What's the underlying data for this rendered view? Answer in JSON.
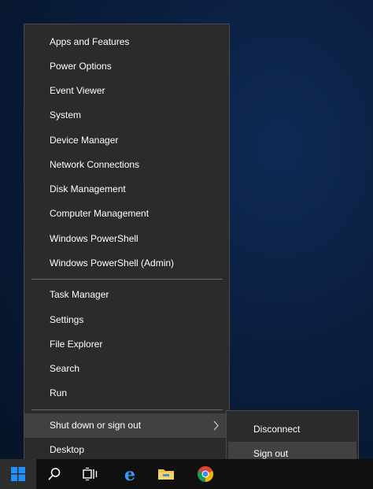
{
  "menu": {
    "items": [
      {
        "label": "Apps and Features"
      },
      {
        "label": "Power Options"
      },
      {
        "label": "Event Viewer"
      },
      {
        "label": "System"
      },
      {
        "label": "Device Manager"
      },
      {
        "label": "Network Connections"
      },
      {
        "label": "Disk Management"
      },
      {
        "label": "Computer Management"
      },
      {
        "label": "Windows PowerShell"
      },
      {
        "label": "Windows PowerShell (Admin)"
      },
      {
        "label": "Task Manager"
      },
      {
        "label": "Settings"
      },
      {
        "label": "File Explorer"
      },
      {
        "label": "Search"
      },
      {
        "label": "Run"
      },
      {
        "label": "Shut down or sign out"
      },
      {
        "label": "Desktop"
      }
    ]
  },
  "submenu": {
    "items": [
      {
        "label": "Disconnect"
      },
      {
        "label": "Sign out"
      }
    ]
  },
  "taskbar": {
    "icons": [
      "windows-start-icon",
      "search-icon",
      "task-view-icon",
      "edge-icon",
      "file-explorer-icon",
      "chrome-icon"
    ]
  },
  "colors": {
    "menu_bg": "#2b2b2b",
    "highlight": "#414141",
    "annotation_red": "#e02020",
    "start_blue": "#1e90ff"
  }
}
